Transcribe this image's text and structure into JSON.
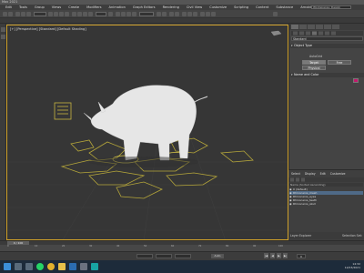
{
  "window": {
    "title": "Max 2021"
  },
  "menubar": {
    "items": [
      "Edit",
      "Tools",
      "Group",
      "Views",
      "Create",
      "Modifiers",
      "Animation",
      "Graph Editors",
      "Rendering",
      "Civil View",
      "Customize",
      "Scripting",
      "Content",
      "Help",
      "Substance",
      "Arnold",
      "Help"
    ],
    "workspace": "Workspaces: Design Standard"
  },
  "viewport": {
    "label": "[+] [Perspective] [Standard] [Default Shading]"
  },
  "command_panel": {
    "dropdown": "Standard",
    "object_type_header": "Object Type",
    "autogrid": "AutoGrid",
    "buttons": [
      "Target",
      "Free",
      "Physical"
    ],
    "name_color_header": "Name and Color",
    "swatch_color": "#c2186b"
  },
  "scene_explorer": {
    "menu": [
      "Select",
      "Display",
      "Edit",
      "Customize"
    ],
    "header": "Name (Sorted Ascending)",
    "rows": [
      "0 (default)",
      "Rhinoceros_mesh",
      "Rhinoceros_eyes",
      "Rhinoceros_teeth",
      "Rhinoceros_skull"
    ],
    "bottom_left": "Layer Explorer",
    "bottom_right": "Selection Set:"
  },
  "timeline": {
    "slider": "0 / 100",
    "ticks": [
      "0",
      "10",
      "20",
      "30",
      "40",
      "50",
      "60",
      "70",
      "80",
      "90",
      "100"
    ]
  },
  "statusbar": {
    "auto_key": "Auto",
    "frame": "0",
    "playback": [
      "|◀",
      "◀",
      "▶",
      "▶|"
    ]
  },
  "taskbar": {
    "time": "14:32",
    "date": "12/03/2021",
    "icons": [
      {
        "name": "start-icon",
        "color": "#3c8fd8"
      },
      {
        "name": "search-icon",
        "color": "#596a7a"
      },
      {
        "name": "task-view-icon",
        "color": "#596a7a"
      },
      {
        "name": "whatsapp-icon",
        "color": "#25d366"
      },
      {
        "name": "chrome-icon",
        "color": "#e2b12c"
      },
      {
        "name": "file-explorer-icon",
        "color": "#e6c04a"
      },
      {
        "name": "media-icon",
        "color": "#2b6cb0"
      },
      {
        "name": "store-icon",
        "color": "#6b7280"
      },
      {
        "name": "3dsmax-icon",
        "color": "#18a3a3"
      }
    ]
  }
}
